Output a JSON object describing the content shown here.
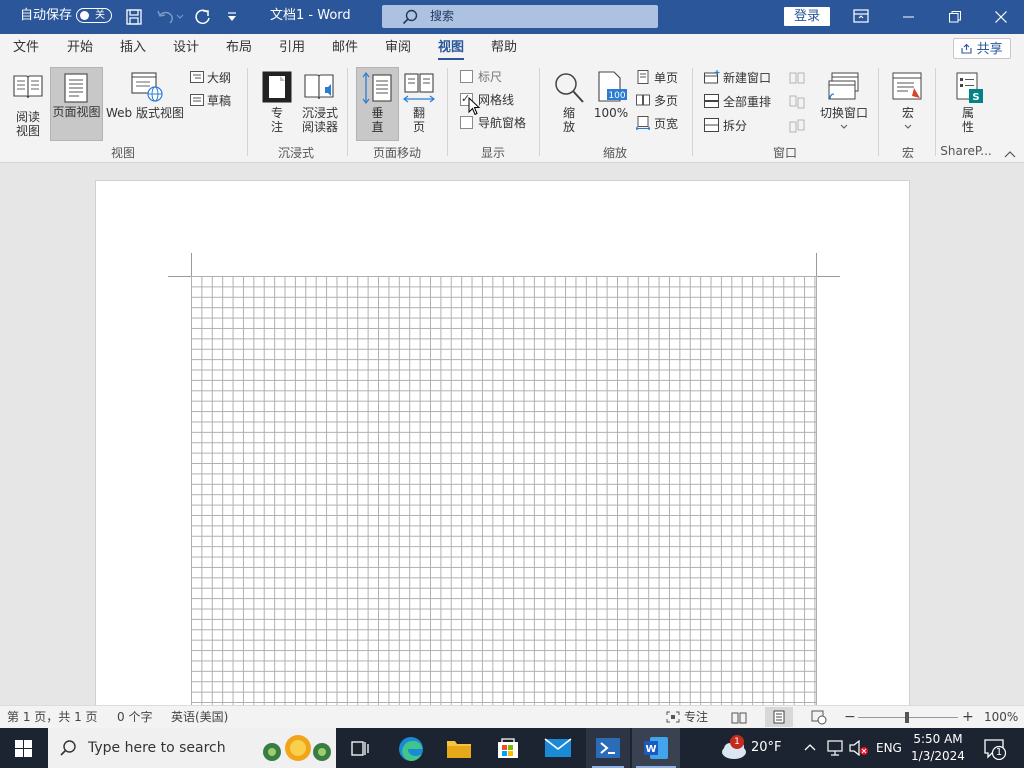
{
  "titlebar": {
    "autosave_label": "自动保存",
    "autosave_state": "关",
    "doc_title": "文档1  -  Word",
    "search_placeholder": "搜索",
    "signin_label": "登录"
  },
  "tabs": [
    "文件",
    "开始",
    "插入",
    "设计",
    "布局",
    "引用",
    "邮件",
    "审阅",
    "视图",
    "帮助"
  ],
  "active_tab": "视图",
  "share_label": "共享",
  "ribbon": {
    "views_group": {
      "label": "视图",
      "read_mode": "阅读\n视图",
      "print_layout": "页面视图",
      "web_layout": "Web 版式视图",
      "outline": "大纲",
      "draft": "草稿"
    },
    "immersive_group": {
      "label": "沉浸式",
      "focus_1": "专",
      "focus_2": "注",
      "reader_1": "沉浸式",
      "reader_2": "阅读器"
    },
    "page_movement_group": {
      "label": "页面移动",
      "vertical_1": "垂",
      "vertical_2": "直",
      "side_1": "翻",
      "side_2": "页"
    },
    "show_group": {
      "label": "显示",
      "ruler": "标尺",
      "gridlines": "网格线",
      "nav_pane": "导航窗格",
      "ruler_checked": false,
      "gridlines_checked": true,
      "nav_pane_checked": false
    },
    "zoom_group": {
      "label": "缩放",
      "zoom_1": "缩",
      "zoom_2": "放",
      "zoom100": "100%",
      "zoom100_icon_text": "100",
      "one_page": "单页",
      "multi_page": "多页",
      "page_width": "页宽"
    },
    "window_group": {
      "label": "窗口",
      "new_window": "新建窗口",
      "arrange_all": "全部重排",
      "split": "拆分",
      "switch_windows": "切换窗口"
    },
    "macros_group": {
      "label": "宏",
      "macros": "宏"
    },
    "sharepoint_group": {
      "label": "ShareP...",
      "props_1": "属",
      "props_2": "性"
    }
  },
  "statusbar": {
    "page_info": "第 1 页，共 1 页",
    "word_count": "0 个字",
    "language": "英语(美国)",
    "focus_label": "专注",
    "zoom_level": "100%",
    "zoom_minus": "−",
    "zoom_plus": "+"
  },
  "taskbar": {
    "search_placeholder": "Type here to search",
    "weather_temp": "20°F",
    "weather_badge": "1",
    "language": "ENG",
    "time": "5:50 AM",
    "date": "1/3/2024",
    "notification_count": "1"
  },
  "colors": {
    "word_blue": "#2b579a",
    "taskbar": "#1c2331",
    "ribbon_bg": "#f3f3f3",
    "canvas_bg": "#e6e6e6"
  }
}
